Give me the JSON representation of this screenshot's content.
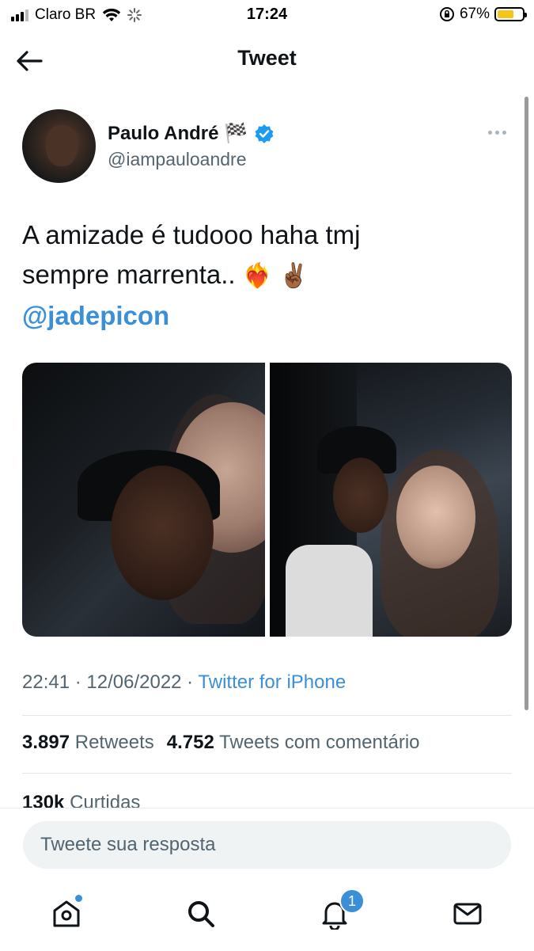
{
  "status_bar": {
    "carrier": "Claro BR",
    "time": "17:24",
    "battery_percent": "67%",
    "battery_level": 0.67,
    "battery_color": "#f5c518"
  },
  "header": {
    "title": "Tweet",
    "back_icon": "arrow-left-icon"
  },
  "tweet": {
    "author": {
      "name": "Paulo André 🏁",
      "handle": "@iampauloandre",
      "verified": true,
      "verified_color": "#1d9bf0"
    },
    "text_line1": "A amizade é tudooo haha tmj",
    "text_line2": "sempre marrenta..",
    "emojis": "❤️‍🔥 ✌🏾",
    "mention": "@jadepicon",
    "photos_count": 2,
    "time": "22:41",
    "date": "12/06/2022",
    "source": "Twitter for iPhone",
    "retweets_count": "3.897",
    "retweets_label": "Retweets",
    "quotes_count": "4.752",
    "quotes_label": "Tweets com comentário",
    "likes_count": "130k",
    "likes_label": "Curtidas"
  },
  "reply": {
    "placeholder": "Tweete sua resposta"
  },
  "tab_bar": {
    "notifications_badge": "1",
    "accent_color": "#3b8fd6"
  }
}
